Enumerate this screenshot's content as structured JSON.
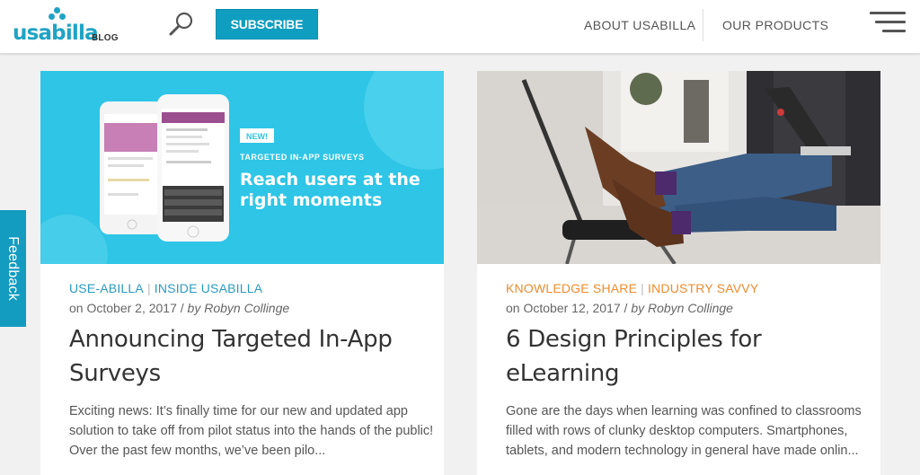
{
  "header": {
    "logo_text": "usabilla",
    "logo_blog": "BLOG",
    "subscribe_label": "SUBSCRIBE",
    "nav": [
      {
        "label": "ABOUT USABILLA"
      },
      {
        "label": "OUR PRODUCTS"
      }
    ],
    "search_icon": "search-icon",
    "menu_icon": "hamburger-menu-icon"
  },
  "feedback_tab": {
    "label": "Feedback"
  },
  "colors": {
    "brand": "#1fa3c4",
    "subscribe": "#0f9ec0",
    "card1_category": "#2a9bc2",
    "card2_category": "#ef8c2e",
    "title": "#333333",
    "text": "#555555"
  },
  "posts": [
    {
      "categories": [
        "USE-ABILLA",
        "INSIDE USABILLA"
      ],
      "date": "on October 2, 2017",
      "author": "by Robyn Collinge",
      "title": "Announcing Targeted In-App Surveys",
      "excerpt": "Exciting news: It’s finally time for our new and updated app solution to take off from pilot status into the hands of the public! Over the past few months, we’ve been pilo...",
      "image": {
        "badge": "NEW!",
        "kicker": "TARGETED IN-APP SURVEYS",
        "headline": "Reach users at the right moments"
      }
    },
    {
      "categories": [
        "KNOWLEDGE SHARE",
        "INDUSTRY SAVVY"
      ],
      "date": "on October 12, 2017",
      "author": "by Robyn Collinge",
      "title": "6 Design Principles for eLearning",
      "excerpt": "Gone are the days when learning was confined to classrooms filled with rows of clunky desktop computers. Smartphones, tablets, and modern technology in general have made onlin..."
    }
  ]
}
